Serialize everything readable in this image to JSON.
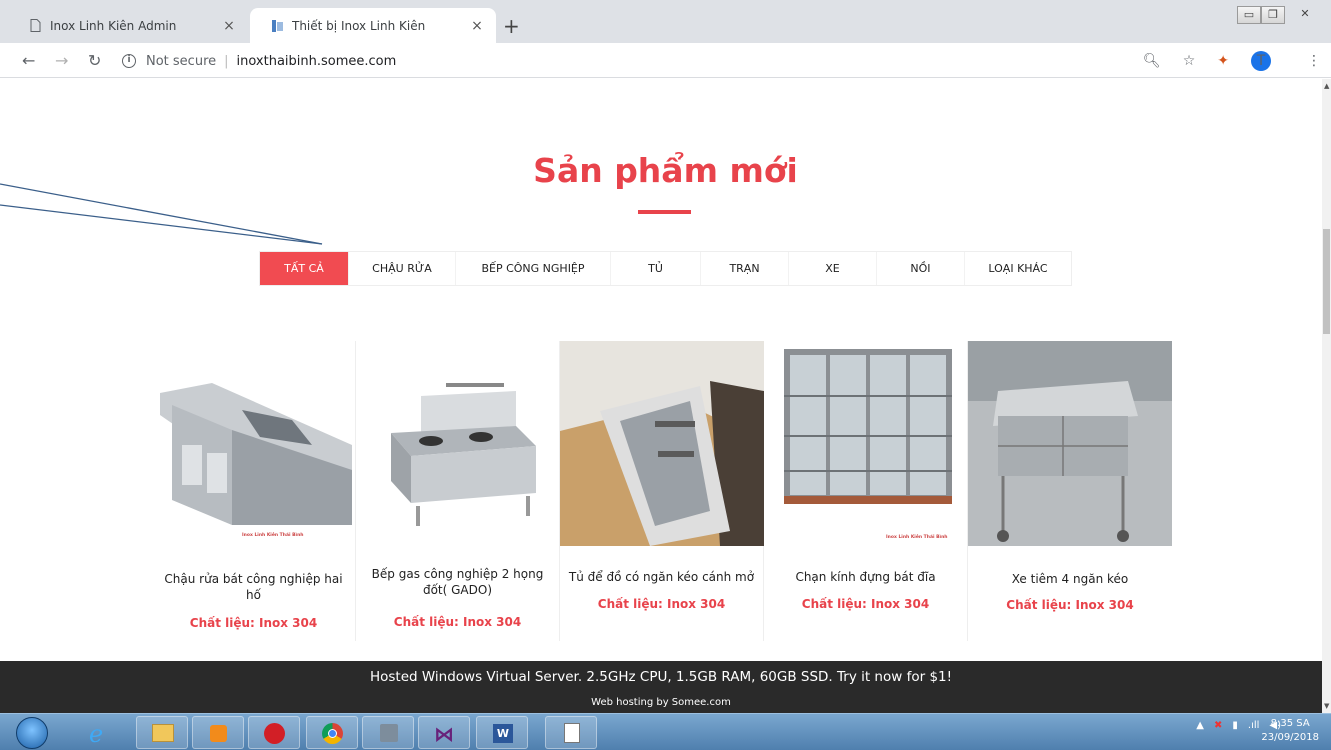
{
  "browser": {
    "tabs": [
      {
        "label": "Inox Linh Kiên Admin",
        "active": false
      },
      {
        "label": "Thiết bị Inox Linh Kiên",
        "active": true
      }
    ],
    "security": "Not secure",
    "url": "inoxthaibinh.somee.com",
    "profile_initial": "T"
  },
  "section": {
    "title": "Sản phẩm mới"
  },
  "filters": [
    {
      "label": "TẤT CẢ",
      "active": true
    },
    {
      "label": "CHẬU RỬA",
      "active": false
    },
    {
      "label": "BẾP CÔNG NGHIỆP",
      "active": false
    },
    {
      "label": "TỦ",
      "active": false
    },
    {
      "label": "TRẠN",
      "active": false
    },
    {
      "label": "XE",
      "active": false
    },
    {
      "label": "NỒI",
      "active": false
    },
    {
      "label": "LOẠI KHÁC",
      "active": false
    }
  ],
  "products": [
    {
      "name": "Chậu rửa bát công nghiệp hai hố",
      "material": "Chất liệu: Inox 304",
      "watermark": "Inox Linh Kiên Thái Bình"
    },
    {
      "name": "Bếp gas công nghiệp 2 họng đốt( GADO)",
      "material": "Chất liệu: Inox 304",
      "watermark": ""
    },
    {
      "name": "Tủ để đồ có ngăn kéo cánh mở",
      "material": "Chất liệu: Inox 304",
      "watermark": ""
    },
    {
      "name": "Chạn kính đựng bát đĩa",
      "material": "Chất liệu: Inox 304",
      "watermark": "Inox Linh Kiên Thái Bình"
    },
    {
      "name": "Xe tiêm 4 ngăn kéo",
      "material": "Chất liệu: Inox 304",
      "watermark": ""
    }
  ],
  "ad": {
    "line1": "Hosted Windows Virtual Server. 2.5GHz CPU, 1.5GB RAM, 60GB SSD. Try it now for $1!",
    "line2": "Web hosting by Somee.com"
  },
  "taskbar": {
    "time": "8:35 SA",
    "date": "23/09/2018"
  },
  "colors": {
    "accent": "#e8434b",
    "filter_active": "#f14b51",
    "ad_bg": "#2a2a2a"
  }
}
